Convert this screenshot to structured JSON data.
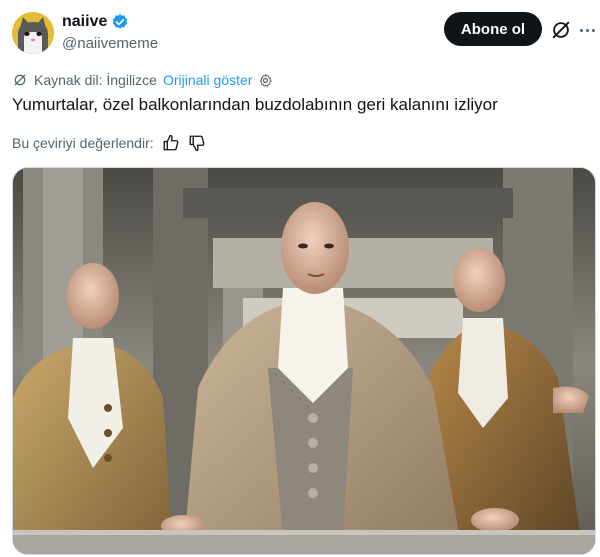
{
  "author": {
    "display_name": "naiive",
    "handle": "@naiivememe",
    "verified": true,
    "avatar_icon": "cat-avatar"
  },
  "actions": {
    "subscribe_label": "Abone ol",
    "grok_icon": "grok-icon",
    "more_icon": "more-icon"
  },
  "translation": {
    "source_label": "Kaynak dil: İngilizce",
    "show_original": "Orijinali göster",
    "rate_label": "Bu çeviriyi değerlendir:"
  },
  "tweet": {
    "text": "Yumurtalar, özel balkonlarından buzdolabının geri kalanını izliyor"
  },
  "colors": {
    "link": "#1d9bf0",
    "verified": "#1d9bf0",
    "secondary_text": "#536471",
    "button_bg": "#0f1419"
  }
}
